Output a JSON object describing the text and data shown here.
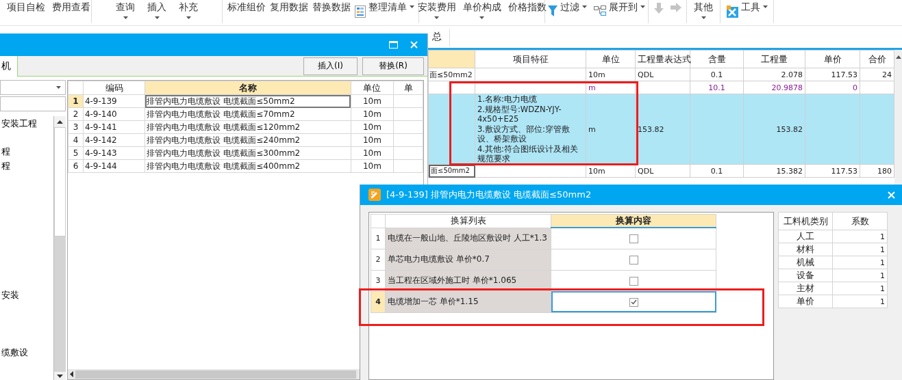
{
  "toolbar": {
    "groups": [
      {
        "items": [
          {
            "label": "项目自检",
            "kind": "text",
            "dropdown": false
          },
          {
            "label": "费用查看",
            "kind": "text",
            "dropdown": false
          }
        ]
      },
      {
        "items": [
          {
            "label": "查询",
            "kind": "text",
            "dropdown": true
          },
          {
            "label": "插入",
            "kind": "text",
            "dropdown": true
          },
          {
            "label": "补充",
            "kind": "text",
            "dropdown": true
          }
        ]
      },
      {
        "items": [
          {
            "label": "标准组价",
            "kind": "text",
            "dropdown": false
          },
          {
            "label": "复用数据",
            "kind": "text",
            "dropdown": false
          },
          {
            "label": "替换数据",
            "kind": "text",
            "dropdown": false
          },
          {
            "label": "整理清单",
            "kind": "icon-text",
            "dropdown": true
          }
        ]
      },
      {
        "items": [
          {
            "label": "安装费用",
            "kind": "text",
            "dropdown": true
          },
          {
            "label": "单价构成",
            "kind": "text",
            "dropdown": true
          },
          {
            "label": "价格指数",
            "kind": "text",
            "dropdown": false
          }
        ]
      },
      {
        "items": [
          {
            "label": "过滤",
            "kind": "icon-text",
            "dropdown": true
          },
          {
            "label": "展开到",
            "kind": "icon-text",
            "dropdown": true
          }
        ]
      },
      {
        "items": [
          {
            "kind": "icon",
            "disabled": true
          },
          {
            "kind": "icon",
            "disabled": true
          }
        ]
      },
      {
        "items": [
          {
            "label": "其他",
            "kind": "text",
            "dropdown": true
          }
        ]
      },
      {
        "items": [
          {
            "label": "工具",
            "kind": "icon-text",
            "dropdown": true
          }
        ]
      }
    ]
  },
  "tab_strip": {
    "tabs": [
      {
        "label": "总"
      }
    ]
  },
  "main_grid": {
    "highlighted": true,
    "columns": [
      {
        "selected": true
      },
      {
        "label": "项目特征",
        "selected": false
      },
      {
        "label": "单位",
        "selected": false
      },
      {
        "label": "工程量表达式",
        "selected": false
      },
      {
        "label": "含量",
        "selected": false
      },
      {
        "label": "工程量",
        "selected": false
      },
      {
        "label": "单价",
        "selected": false
      },
      {
        "label": "合价",
        "selected": false
      }
    ],
    "rows": [
      {
        "kind": "item",
        "focused": false,
        "cells": [
          "面≤50mm2",
          null,
          "10m",
          "QDL",
          "0.1",
          "2.078",
          "117.53",
          "24"
        ]
      },
      {
        "kind": "sub",
        "focused": false,
        "cells": [
          null,
          null,
          "m",
          null,
          "10.1",
          "20.9878",
          "0",
          null
        ]
      },
      {
        "kind": "feature",
        "focused": false,
        "cells": [
          null,
          "1.名称:电力电缆\n2.规格型号:WDZN-YJY-4x50+E25\n3.敷设方式、部位:穿管敷设、桥架敷设\n4.其他:符合图纸设计及相关规范要求",
          "m",
          "153.82",
          null,
          "153.82",
          null,
          null
        ]
      },
      {
        "kind": "item",
        "focused": true,
        "cells": [
          "面≤50mm2",
          null,
          "10m",
          "QDL",
          "0.1",
          "15.382",
          "117.53",
          "180"
        ]
      }
    ]
  },
  "left_dialog": {
    "tab": {
      "label": "机"
    },
    "buttons": [
      "插入(I)",
      "替换(R)"
    ],
    "tree": [
      {
        "label": "安装工程"
      },
      {
        "label": "程"
      },
      {
        "label": "程"
      },
      {
        "label": "安装"
      },
      {
        "label": "缆敷设"
      }
    ],
    "grid": {
      "columns": [
        {
          "label": "编码",
          "selected": false
        },
        {
          "label": "名称",
          "selected": true
        },
        {
          "label": "单位",
          "selected": false
        },
        {
          "label": "单",
          "selected": false
        }
      ],
      "rows": [
        {
          "num": "1",
          "code": "4-9-139",
          "name": "排管内电力电缆敷设 电缆截面≤50mm2",
          "unit": "10m",
          "selected": true
        },
        {
          "num": "2",
          "code": "4-9-140",
          "name": "排管内电力电缆敷设 电缆截面≤70mm2",
          "unit": "10m",
          "selected": false
        },
        {
          "num": "3",
          "code": "4-9-141",
          "name": "排管内电力电缆敷设 电缆截面≤120mm2",
          "unit": "10m",
          "selected": false
        },
        {
          "num": "4",
          "code": "4-9-142",
          "name": "排管内电力电缆敷设 电缆截面≤240mm2",
          "unit": "10m",
          "selected": false
        },
        {
          "num": "5",
          "code": "4-9-143",
          "name": "排管内电力电缆敷设 电缆截面≤300mm2",
          "unit": "10m",
          "selected": false
        },
        {
          "num": "6",
          "code": "4-9-144",
          "name": "排管内电力电缆敷设 电缆截面≤400mm2",
          "unit": "10m",
          "selected": false
        }
      ]
    }
  },
  "conversion_dialog": {
    "title": "[4-9-139] 排管内电力电缆敷设 电缆截面≤50mm2",
    "highlighted": true,
    "columns": [
      {
        "label": "换算列表",
        "selected": false
      },
      {
        "label": "换算内容",
        "selected": true
      }
    ],
    "rows": [
      {
        "num": "1",
        "text": "电缆在一般山地、丘陵地区敷设时 人工*1.3",
        "checked": false,
        "selected": false
      },
      {
        "num": "2",
        "text": "单芯电力电缆敷设 单价*0.7",
        "checked": false,
        "selected": false
      },
      {
        "num": "3",
        "text": "当工程在区域外施工时 单价*1.065",
        "checked": false,
        "selected": false
      },
      {
        "num": "4",
        "text": "电缆增加一芯 单价*1.15",
        "checked": true,
        "selected": true
      }
    ],
    "factors": {
      "columns": [
        "工料机类别",
        "系数"
      ],
      "rows": [
        {
          "category": "人工",
          "factor": "1"
        },
        {
          "category": "材料",
          "factor": "1"
        },
        {
          "category": "机械",
          "factor": "1"
        },
        {
          "category": "设备",
          "factor": "1"
        },
        {
          "category": "主材",
          "factor": "1"
        },
        {
          "category": "单价",
          "factor": "1"
        }
      ]
    }
  }
}
